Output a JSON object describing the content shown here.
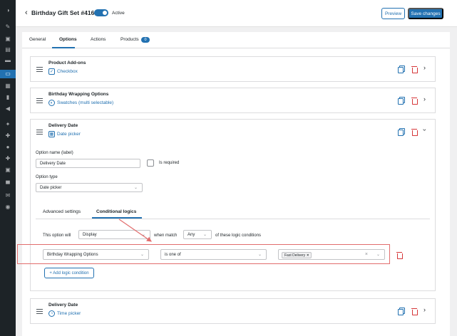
{
  "header": {
    "back_label": "‹",
    "title": "Birthday Gift Set #416",
    "status": "Active",
    "preview_label": "Preview",
    "save_label": "Save changes"
  },
  "tabs": [
    {
      "label": "General"
    },
    {
      "label": "Options"
    },
    {
      "label": "Actions"
    },
    {
      "label": "Products"
    }
  ],
  "products_count": "0",
  "options": [
    {
      "title": "Product Add-ons",
      "type": "Checkbox",
      "icon": "checkbox-icon"
    },
    {
      "title": "Birthday Wrapping Options",
      "type": "Swatches (multi selectable)",
      "icon": "palette-icon"
    },
    {
      "title": "Delivery Date",
      "type": "Date picker",
      "icon": "calendar-icon"
    },
    {
      "title": "Delivery Date",
      "type": "Time picker",
      "icon": "clock-icon"
    }
  ],
  "expanded": {
    "name_label": "Option name (label)",
    "name_value": "Delivery Date",
    "required_label": "Is required",
    "type_label": "Option type",
    "type_value": "Date picker",
    "subtabs": [
      {
        "label": "Advanced settings"
      },
      {
        "label": "Conditional logics"
      }
    ],
    "logic": {
      "prefix": "This option will",
      "action_value": "Display",
      "when_match": "when match",
      "match_value": "Any",
      "suffix": "of these logic conditions",
      "condition_field": "Birthday Wrapping Options",
      "condition_operator": "is one of",
      "condition_tag": "Fast Delivery",
      "tag_remove": "×",
      "clear": "×",
      "add_label": "+ Add logic condition"
    }
  },
  "colors": {
    "accent": "#2271b1",
    "danger": "#d63638",
    "highlight": "#e26d6d",
    "sidebar": "#1d2327"
  }
}
